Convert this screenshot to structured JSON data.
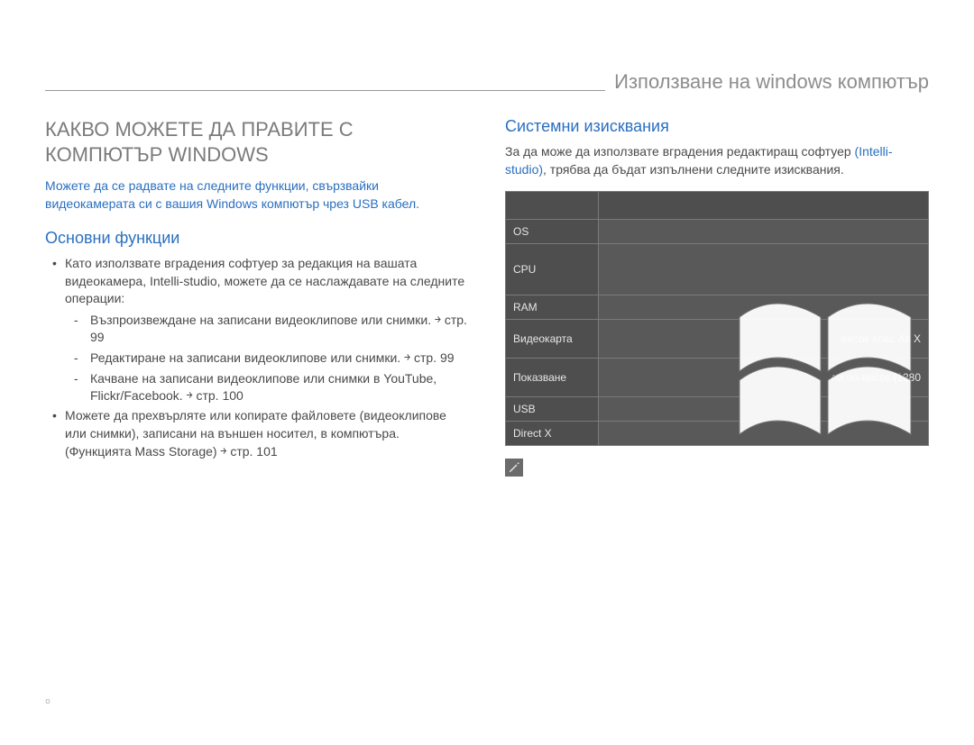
{
  "chapter_title": "Използване на windows компютър",
  "left": {
    "section_title": "КАКВО МОЖЕТЕ ДА ПРАВИТЕ С КОМПЮТЪР WINDOWS",
    "intro": "Можете да се радвате на следните функции, свързвайки видеокамерата си с вашия Windows компютър чрез USB кабел.",
    "sub_heading": "Основни функции",
    "bullet1": "Като използвате вградения софтуер за редакция на вашата видеокамера, Intelli-studio, можете да се наслаждавате на следните операции:",
    "dash1": "Възпроизвеждане на записани видеоклипове или снимки. ￫ стр. 99",
    "dash2": "Редактиране на записани видеоклипове или снимки. ￫ стр. 99",
    "dash3": "Качване на записани видеоклипове или снимки в YouTube, Flickr/Facebook. ￫ стр. 100",
    "bullet2": "Можете да прехвърляте или копирате файловете (видеоклипове или снимки), записани на външен носител, в компютъра. (Функцията Mass Storage) ￫ стр. 101"
  },
  "right": {
    "sub_heading": "Системни изисквания",
    "intro_plain": "За да може да използвате вградения редактиращ софтуер ",
    "intro_blue": "(Intelli-studio)",
    "intro_tail": ", трябва да бъдат изпълнени следните изисквания.",
    "table_header_left": "",
    "table_header_right": "",
    "rows": {
      "os_label": "OS",
      "os_val": "",
      "cpu_label": "CPU",
      "cpu_val": "",
      "ram_label": "RAM",
      "ram_val": "",
      "gpu_label": "Видеокарта",
      "gpu_val_tail": "висок клас Ati X",
      "disp_label": "Показване",
      "disp_val_tail": "ли по-висок (1280",
      "usb_label": "USB",
      "usb_val": "",
      "dx_label": "Direct X",
      "dx_val": ""
    }
  },
  "page_number": "￮"
}
